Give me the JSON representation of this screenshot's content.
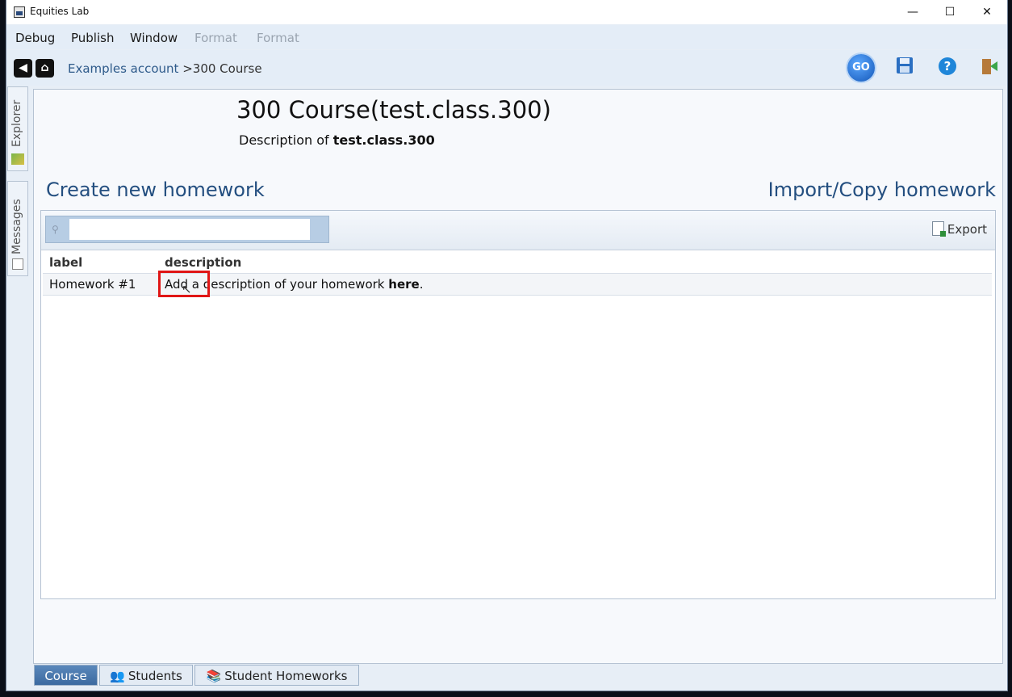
{
  "window": {
    "title": "Equities Lab"
  },
  "menu": [
    {
      "label": "Debug",
      "enabled": true
    },
    {
      "label": "Publish",
      "enabled": true
    },
    {
      "label": "Window",
      "enabled": true
    },
    {
      "label": "Format",
      "enabled": false
    },
    {
      "label": "Format",
      "enabled": false
    }
  ],
  "breadcrumb": {
    "link": "Examples account",
    "separator": ">",
    "current": "300 Course"
  },
  "toolbar": {
    "go_label": "GO"
  },
  "side_tabs": {
    "explorer": "Explorer",
    "messages": "Messages"
  },
  "course": {
    "title": "300 Course(test.class.300)",
    "description_prefix": "Description of",
    "description_code": "test.class.300"
  },
  "actions": {
    "create": "Create new homework",
    "import": "Import/Copy homework"
  },
  "search": {
    "value": "",
    "placeholder": ""
  },
  "export_label": "Export",
  "table": {
    "columns": [
      "label",
      "description"
    ],
    "rows": [
      {
        "label": "Homework  #1",
        "description_text": "Add a description of your homework",
        "description_bold": "here",
        "description_end": "."
      }
    ]
  },
  "bottom_tabs": [
    {
      "label": "Course",
      "active": true
    },
    {
      "label": "Students",
      "active": false
    },
    {
      "label": "Student Homeworks",
      "active": false
    }
  ]
}
